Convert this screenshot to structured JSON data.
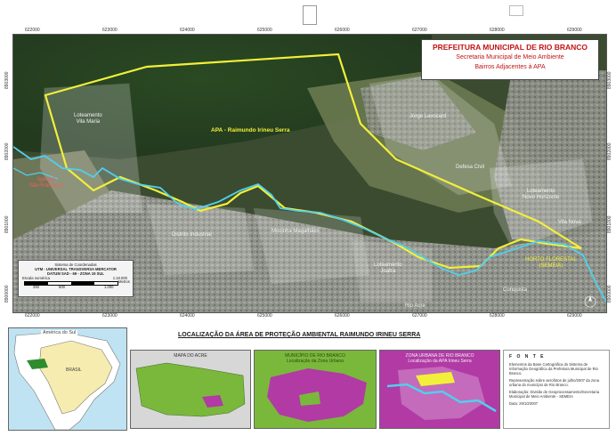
{
  "header": {
    "title": "PREFEITURA MUNICIPAL DE RIO BRANCO",
    "subtitle": "Secretaria Municipal de Meio Ambiente",
    "layer_title": "Bairros Adjacentes à APA"
  },
  "top_coords": [
    "622000",
    "623000",
    "624000",
    "625000",
    "626000",
    "627000",
    "628000",
    "629000"
  ],
  "bottom_coords": [
    "622000",
    "623000",
    "624000",
    "625000",
    "626000",
    "627000",
    "628000",
    "629000"
  ],
  "left_coords": [
    "8903000",
    "8902000",
    "8901000",
    "8900000"
  ],
  "right_coords": [
    "8903000",
    "8902000",
    "8901000",
    "8900000"
  ],
  "labels": {
    "apa": "APA - Raimundo Irineu Serra",
    "vila_maria": "Loteamento\nVila Maria",
    "jorge_lavocard": "Jorge Lavocard",
    "defesa_civil": "Defesa Civil",
    "novo_horizonte": "Loteamento\nNovo Horizonte",
    "vila_nova": "Vila Nova",
    "igarape": "Igarapé\nSão Francisco",
    "distrito": "Distrito Industrial",
    "mocinha": "Mocinha Magalhães",
    "joafra": "Loteamento\nJoafra",
    "horto": "HORTO FLORESTAL\n(SEMEIA)",
    "conquista": "Conquista",
    "rio_acre": "Rio Acre"
  },
  "coord_system": {
    "line1": "Sistema de Coordenadas",
    "line2": "UTM - UNIVERSAL TRANSVERSA MERCATOR",
    "line3": "DATUM SAD - 69 - ZONA 19 SUL",
    "scale_label": "Escala numérica",
    "scale_ratio": "1:18.000",
    "scale_ticks": [
      "250",
      "500",
      "1.000"
    ],
    "scale_unit": "Metros"
  },
  "bottom_title": "LOCALIZAÇÃO DA ÁREA DE PROTEÇÃO AMBIENTAL RAIMUNDO IRINEU SERRA",
  "inset_brazil": {
    "label_top": "América do Sul",
    "label_country": "BRASIL"
  },
  "panels": [
    {
      "title": "MAPA DO ACRE"
    },
    {
      "title": "MUNICÍPIO DE RIO BRANCO\nLocalização da Zona Urbana"
    },
    {
      "title": "ZONA URBANA DE RIO BRANCO\nLocalização da APA Irineu Serra"
    }
  ],
  "fonte": {
    "header": "F O N T E",
    "p1": "Elementos da Base Cartográfica do Sistema de Informação Geográfica da Prefeitura Municipal de Rio Branco.",
    "p2": "Representação sobre aerofotos de julho/2007 da zona urbana do município de Rio Branco.",
    "p3": "Elaboração: Divisão de Geoprocessamento/Secretaria Municipal de Meio Ambiente - SEMEIA",
    "p4": "Data: 29/10/2007"
  },
  "colors": {
    "apa_boundary": "#f2ef3a",
    "river": "#4fd0ee",
    "title_red": "#c31414",
    "panel_green": "#7ab83c",
    "panel_magenta": "#b13aa5"
  }
}
